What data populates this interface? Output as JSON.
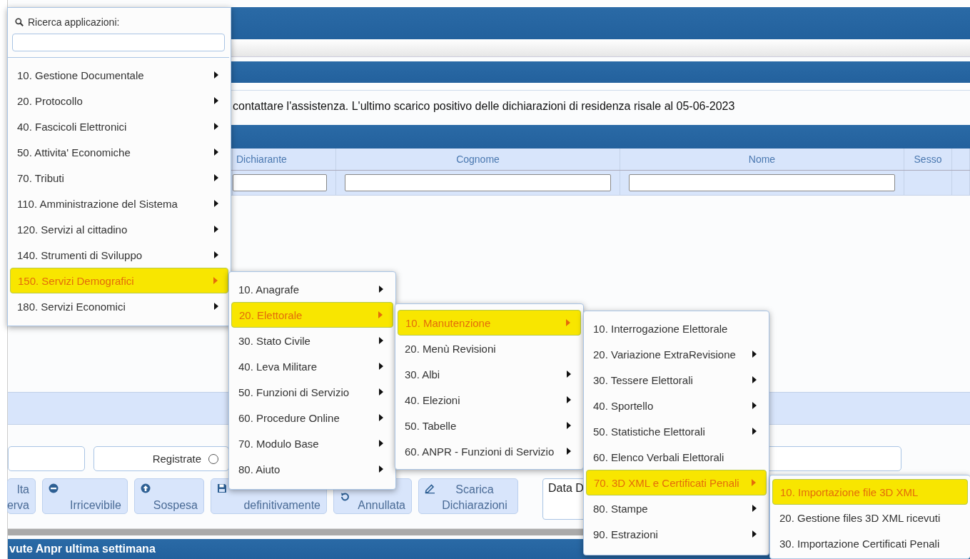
{
  "app_search": {
    "label": "Ricerca applicazioni:"
  },
  "message": "contattare l'assistenza. L'ultimo scarico positivo delle dichiarazioni di residenza risale al 05-06-2023",
  "table": {
    "columns": [
      "Dichiarante",
      "Cognome",
      "Nome",
      "Sesso"
    ]
  },
  "status_filters": [
    {
      "label": "Registrate",
      "selected": false
    }
  ],
  "buttons": [
    {
      "kind": "plain",
      "lines": [
        "lta",
        "erva"
      ]
    },
    {
      "kind": "reject",
      "lines": [
        "Irricevibile"
      ]
    },
    {
      "kind": "suspend",
      "lines": [
        "Sospesa"
      ]
    },
    {
      "kind": "save",
      "lines": [
        "definitivamente"
      ]
    },
    {
      "kind": "cancel",
      "lines": [
        "Annullata"
      ]
    },
    {
      "kind": "download",
      "lines": [
        "Scarica",
        "Dichiarazioni"
      ]
    }
  ],
  "date_field": {
    "label": "Data D"
  },
  "bottom_bar": {
    "title": "vute Anpr ultima settimana"
  },
  "menus": [
    {
      "items": [
        {
          "label": "10. Gestione Documentale",
          "submenu": true,
          "selected": false
        },
        {
          "label": "20. Protocollo",
          "submenu": true,
          "selected": false
        },
        {
          "label": "40. Fascicoli Elettronici",
          "submenu": true,
          "selected": false
        },
        {
          "label": "50. Attivita' Economiche",
          "submenu": true,
          "selected": false
        },
        {
          "label": "70. Tributi",
          "submenu": true,
          "selected": false
        },
        {
          "label": "110. Amministrazione del Sistema",
          "submenu": true,
          "selected": false
        },
        {
          "label": "120. Servizi al cittadino",
          "submenu": true,
          "selected": false
        },
        {
          "label": "140. Strumenti di Sviluppo",
          "submenu": true,
          "selected": false
        },
        {
          "label": "150. Servizi Demografici",
          "submenu": true,
          "selected": true
        },
        {
          "label": "180. Servizi Economici",
          "submenu": true,
          "selected": false
        }
      ]
    },
    {
      "items": [
        {
          "label": "10. Anagrafe",
          "submenu": true,
          "selected": false
        },
        {
          "label": "20. Elettorale",
          "submenu": true,
          "selected": true
        },
        {
          "label": "30. Stato Civile",
          "submenu": true,
          "selected": false
        },
        {
          "label": "40. Leva Militare",
          "submenu": true,
          "selected": false
        },
        {
          "label": "50. Funzioni di Servizio",
          "submenu": true,
          "selected": false
        },
        {
          "label": "60. Procedure Online",
          "submenu": true,
          "selected": false
        },
        {
          "label": "70. Modulo Base",
          "submenu": true,
          "selected": false
        },
        {
          "label": "80. Aiuto",
          "submenu": true,
          "selected": false
        }
      ]
    },
    {
      "items": [
        {
          "label": "10. Manutenzione",
          "submenu": true,
          "selected": true
        },
        {
          "label": "20. Menù Revisioni",
          "submenu": false,
          "selected": false
        },
        {
          "label": "30. Albi",
          "submenu": true,
          "selected": false
        },
        {
          "label": "40. Elezioni",
          "submenu": true,
          "selected": false
        },
        {
          "label": "50. Tabelle",
          "submenu": true,
          "selected": false
        },
        {
          "label": "60. ANPR - Funzioni di Servizio",
          "submenu": true,
          "selected": false
        }
      ]
    },
    {
      "items": [
        {
          "label": "10. Interrogazione Elettorale",
          "submenu": false,
          "selected": false
        },
        {
          "label": "20. Variazione ExtraRevisione",
          "submenu": true,
          "selected": false
        },
        {
          "label": "30. Tessere Elettorali",
          "submenu": true,
          "selected": false
        },
        {
          "label": "40. Sportello",
          "submenu": true,
          "selected": false
        },
        {
          "label": "50. Statistiche Elettorali",
          "submenu": true,
          "selected": false
        },
        {
          "label": "60. Elenco Verbali Elettorali",
          "submenu": false,
          "selected": false
        },
        {
          "label": "70. 3D XML e Certificati Penali",
          "submenu": true,
          "selected": true
        },
        {
          "label": "80. Stampe",
          "submenu": true,
          "selected": false
        },
        {
          "label": "90. Estrazioni",
          "submenu": true,
          "selected": false
        }
      ]
    },
    {
      "items": [
        {
          "label": "10. Importazione file 3D XML",
          "submenu": false,
          "selected": true
        },
        {
          "label": "20. Gestione files 3D XML ricevuti",
          "submenu": false,
          "selected": false
        },
        {
          "label": "30. Importazione Certificati Penali",
          "submenu": false,
          "selected": false
        }
      ]
    }
  ]
}
